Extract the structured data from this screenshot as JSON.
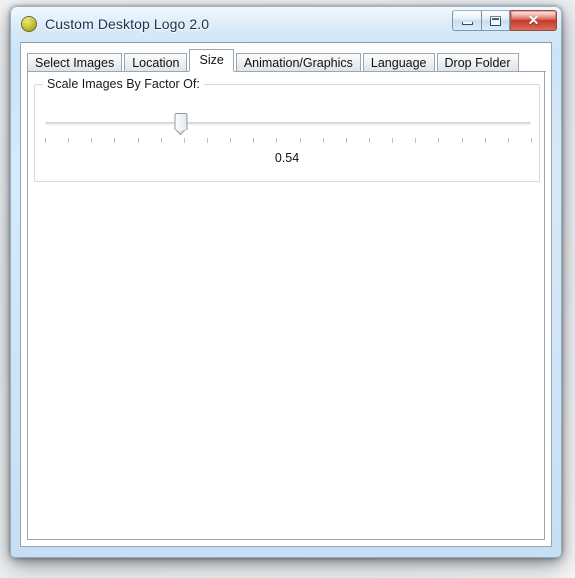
{
  "window": {
    "title": "Custom Desktop Logo 2.0",
    "app_icon": "yellow-circle-logo-icon",
    "controls": {
      "minimize_label": "–",
      "maximize_label": "□",
      "close_label": "✕",
      "close_color": "#c53a2b"
    }
  },
  "tabs": [
    {
      "label": "Select Images",
      "active": false
    },
    {
      "label": "Location",
      "active": false
    },
    {
      "label": "Size",
      "active": true
    },
    {
      "label": "Animation/Graphics",
      "active": false
    },
    {
      "label": "Language",
      "active": false
    },
    {
      "label": "Drop Folder",
      "active": false
    }
  ],
  "size_panel": {
    "group_label": "Scale Images By Factor Of:",
    "slider": {
      "value": "0.54",
      "value_number": 0.54,
      "min": 0,
      "max": 2,
      "position_percent": 28,
      "tick_count": 22
    }
  },
  "colors": {
    "frame_glass": "#c6e0f6",
    "titlebar_text": "#17334e",
    "client_background": "#ffffff",
    "group_border": "#d0dce6",
    "tab_border": "#9aa6b0"
  }
}
